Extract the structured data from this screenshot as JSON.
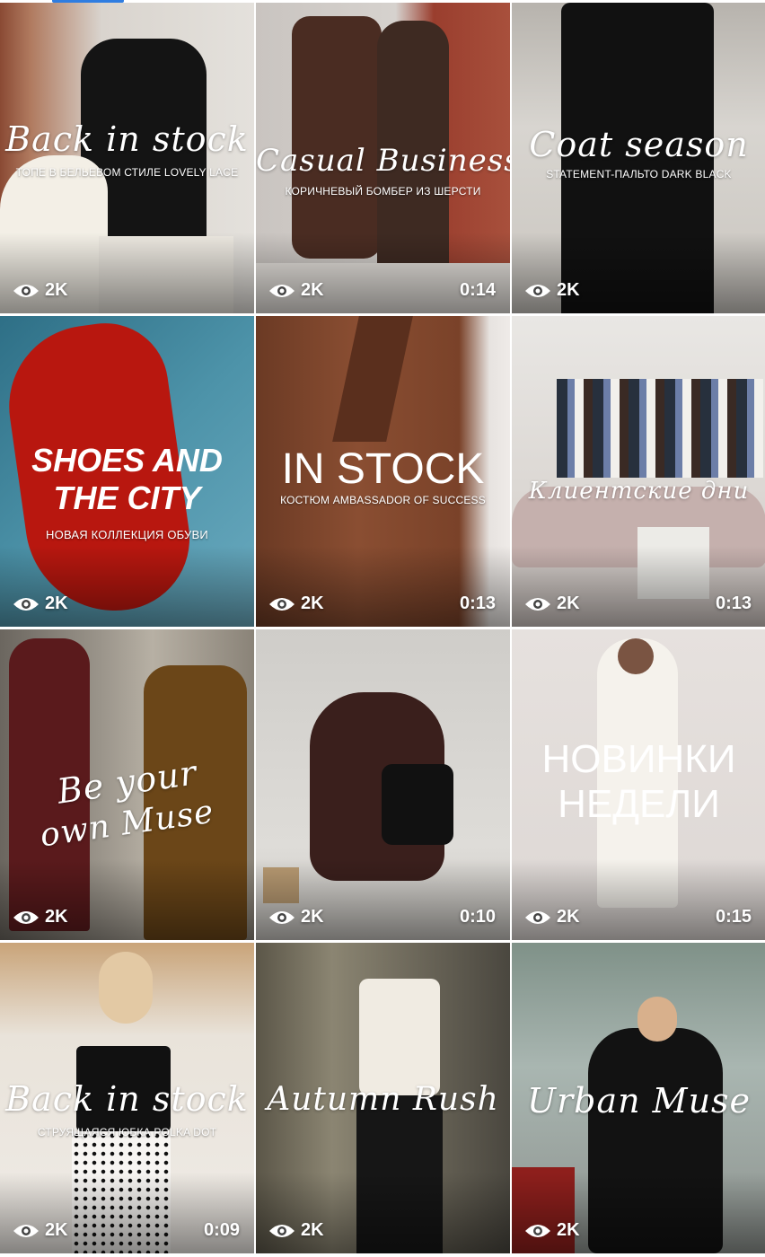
{
  "colors": {
    "accent": "#2f7de1",
    "overlay_text": "#ffffff"
  },
  "icons": {
    "views": "eye-icon"
  },
  "tiles": [
    {
      "script": "Back in stock",
      "caption": "ТОПЕ В БЕЛЬЕВОМ СТИЛЕ LOVELY LACE",
      "views": "2K",
      "duration": ""
    },
    {
      "script": "Casual Business",
      "caption": "КОРИЧНЕВЫЙ БОМБЕР ИЗ ШЕРСТИ",
      "views": "2K",
      "duration": "0:14"
    },
    {
      "script": "Coat season",
      "caption": "STATEMENT-ПАЛЬТО DARK BLACK",
      "views": "2K",
      "duration": ""
    },
    {
      "headline_line1": "SHOES AND",
      "headline_line2": "THE CITY",
      "caption": "НОВАЯ КОЛЛЕКЦИЯ ОБУВИ",
      "views": "2K",
      "duration": ""
    },
    {
      "headline": "IN STOCK",
      "caption": "КОСТЮМ AMBASSADOR OF SUCCESS",
      "views": "2K",
      "duration": "0:13"
    },
    {
      "script": "Клиентские дни",
      "views": "2K",
      "duration": "0:13"
    },
    {
      "script_line1": "Be your",
      "script_line2": "own Muse",
      "views": "2K",
      "duration": ""
    },
    {
      "views": "2K",
      "duration": "0:10"
    },
    {
      "headline_line1": "НОВИНКИ",
      "headline_line2": "НЕДЕЛИ",
      "views": "2K",
      "duration": "0:15"
    },
    {
      "script": "Back in stock",
      "caption": "СТРУЯЩАЯСЯ ЮБКА POLKA DOT",
      "views": "2K",
      "duration": "0:09"
    },
    {
      "script": "Autumn Rush",
      "views": "2K",
      "duration": ""
    },
    {
      "script": "Urban Muse",
      "views": "2K",
      "duration": ""
    }
  ]
}
